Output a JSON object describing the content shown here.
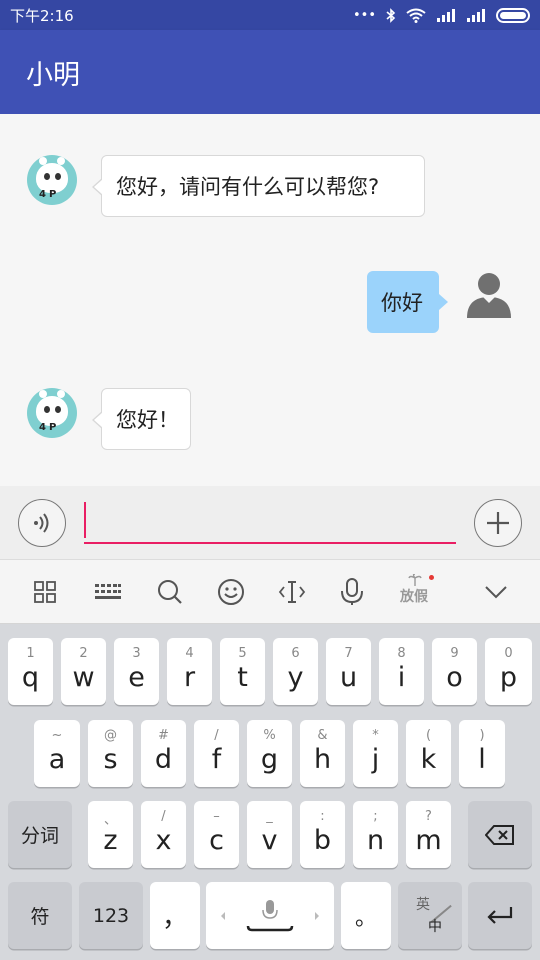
{
  "status": {
    "time": "下午2:16",
    "dots": "•••"
  },
  "app": {
    "title": "小明"
  },
  "messages": [
    {
      "side": "left",
      "text": "您好，请问有什么可以帮您?"
    },
    {
      "side": "right",
      "text": "你好"
    },
    {
      "side": "left",
      "text": "您好！"
    }
  ],
  "input": {
    "value": ""
  },
  "toolbar": {
    "holiday_label": "放假"
  },
  "keyboard": {
    "row1": [
      {
        "hint": "1",
        "key": "q"
      },
      {
        "hint": "2",
        "key": "w"
      },
      {
        "hint": "3",
        "key": "e"
      },
      {
        "hint": "4",
        "key": "r"
      },
      {
        "hint": "5",
        "key": "t"
      },
      {
        "hint": "6",
        "key": "y"
      },
      {
        "hint": "7",
        "key": "u"
      },
      {
        "hint": "8",
        "key": "i"
      },
      {
        "hint": "9",
        "key": "o"
      },
      {
        "hint": "0",
        "key": "p"
      }
    ],
    "row2": [
      {
        "hint": "~",
        "key": "a"
      },
      {
        "hint": "@",
        "key": "s"
      },
      {
        "hint": "#",
        "key": "d"
      },
      {
        "hint": "/",
        "key": "f"
      },
      {
        "hint": "%",
        "key": "g"
      },
      {
        "hint": "&",
        "key": "h"
      },
      {
        "hint": "*",
        "key": "j"
      },
      {
        "hint": "(",
        "key": "k"
      },
      {
        "hint": ")",
        "key": "l"
      }
    ],
    "row3": [
      {
        "hint": "、",
        "key": "z"
      },
      {
        "hint": "/",
        "key": "x"
      },
      {
        "hint": "–",
        "key": "c"
      },
      {
        "hint": "_",
        "key": "v"
      },
      {
        "hint": ":",
        "key": "b"
      },
      {
        "hint": ";",
        "key": "n"
      },
      {
        "hint": "?",
        "key": "m"
      }
    ],
    "segment_label": "分词",
    "symbol_label": "符",
    "number_label": "123",
    "comma_label": "，",
    "period_label": "。",
    "lang_top": "英",
    "lang_bottom": "中"
  },
  "colors": {
    "status_bar": "#3547a3",
    "app_bar": "#3f51b5",
    "bubble_right": "#9bd3fb",
    "input_accent": "#e91e63",
    "bot_avatar": "#7fcfd0"
  }
}
